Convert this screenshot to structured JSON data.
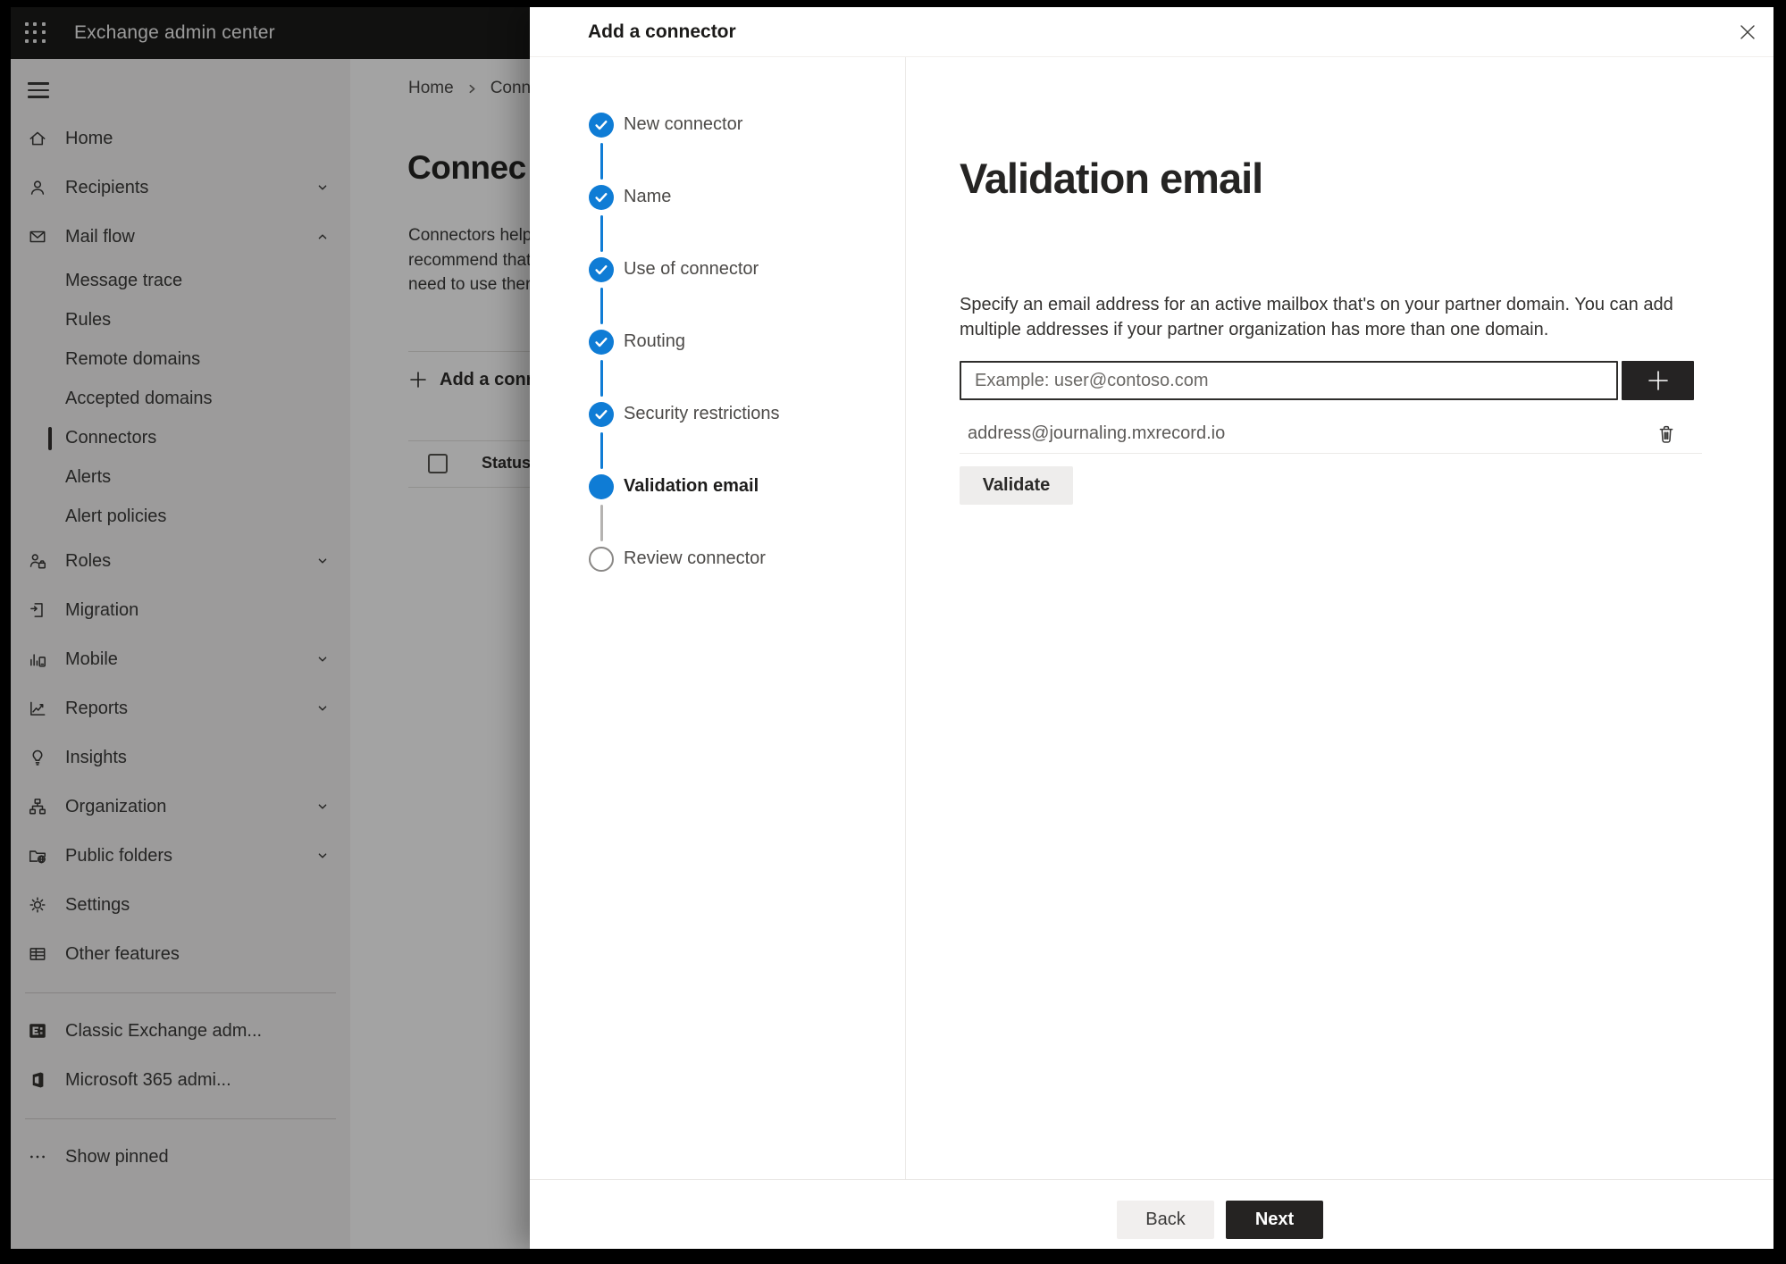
{
  "topbar": {
    "title": "Exchange admin center"
  },
  "sidebar": {
    "items": [
      {
        "label": "Home"
      },
      {
        "label": "Recipients"
      },
      {
        "label": "Mail flow"
      },
      {
        "label": "Message trace"
      },
      {
        "label": "Rules"
      },
      {
        "label": "Remote domains"
      },
      {
        "label": "Accepted domains"
      },
      {
        "label": "Connectors",
        "selected": true
      },
      {
        "label": "Alerts"
      },
      {
        "label": "Alert policies"
      },
      {
        "label": "Roles"
      },
      {
        "label": "Migration"
      },
      {
        "label": "Mobile"
      },
      {
        "label": "Reports"
      },
      {
        "label": "Insights"
      },
      {
        "label": "Organization"
      },
      {
        "label": "Public folders"
      },
      {
        "label": "Settings"
      },
      {
        "label": "Other features"
      },
      {
        "label": "Classic Exchange adm..."
      },
      {
        "label": "Microsoft 365 admi..."
      },
      {
        "label": "Show pinned"
      }
    ]
  },
  "page": {
    "breadcrumb": {
      "home": "Home",
      "current": "Conne"
    },
    "title": "Connec",
    "description_lines": [
      "Connectors help",
      "recommend that",
      "need to use ther"
    ],
    "add_connector_button": "Add a conn",
    "table": {
      "status_column": "Status"
    }
  },
  "wizard": {
    "title": "Add a connector",
    "steps": [
      {
        "label": "New connector",
        "state": "complete"
      },
      {
        "label": "Name",
        "state": "complete"
      },
      {
        "label": "Use of connector",
        "state": "complete"
      },
      {
        "label": "Routing",
        "state": "complete"
      },
      {
        "label": "Security restrictions",
        "state": "complete"
      },
      {
        "label": "Validation email",
        "state": "current"
      },
      {
        "label": "Review connector",
        "state": "upcoming"
      }
    ],
    "content": {
      "heading": "Validation email",
      "description": "Specify an email address for an active mailbox that's on your partner domain. You can add multiple addresses if your partner organization has more than one domain.",
      "email_input": {
        "value": "",
        "placeholder": "Example: user@contoso.com"
      },
      "emails": [
        {
          "address": "address@journaling.mxrecord.io"
        }
      ],
      "validate_button": "Validate"
    },
    "footer": {
      "back_button": "Back",
      "next_button": "Next"
    }
  },
  "colors": {
    "accent_blue": "#0f7cd5",
    "topbar_bg": "#1b1b1a",
    "next_button_bg": "#252322",
    "sidebar_bg": "#f4f3f2"
  }
}
